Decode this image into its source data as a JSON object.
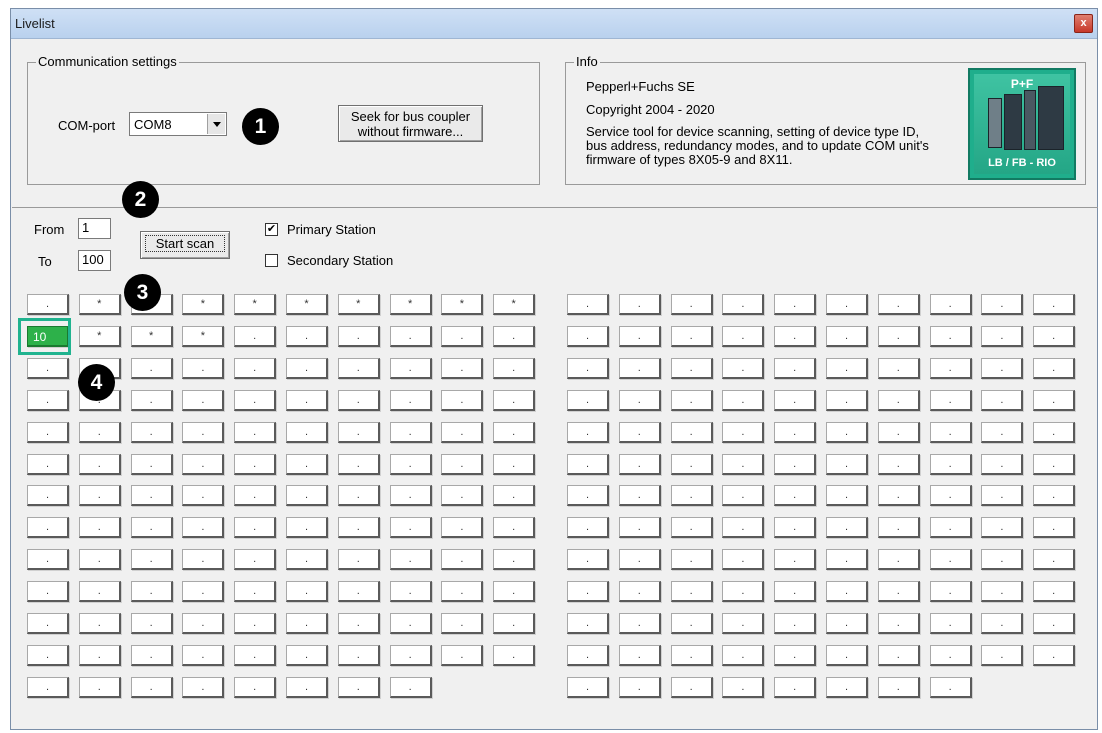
{
  "window": {
    "title": "Livelist",
    "close_label": "x"
  },
  "comm": {
    "legend": "Communication settings",
    "com_port_label": "COM-port",
    "com_port_value": "COM8",
    "seek_button": [
      "Seek for bus coupler",
      "without firmware..."
    ]
  },
  "info": {
    "legend": "Info",
    "company": "Pepperl+Fuchs SE",
    "copyright": "Copyright 2004 - 2020",
    "description": [
      "Service tool for device scanning, setting of device type ID,",
      "bus address, redundancy modes, and to update COM unit's",
      "firmware of types 8X05-9 and 8X11."
    ],
    "logo_top": "P+F",
    "logo_bottom": "LB / FB - RIO"
  },
  "scan": {
    "from_label": "From",
    "from_value": "1",
    "to_label": "To",
    "to_value": "100",
    "start_button": "Start scan",
    "primary_label": "Primary Station",
    "primary_checked": true,
    "secondary_label": "Secondary Station",
    "secondary_checked": false
  },
  "markers": [
    "1",
    "2",
    "3",
    "4"
  ],
  "grid": {
    "row_counts": [
      10,
      10,
      10,
      10,
      10,
      10,
      10,
      10,
      10,
      10,
      10,
      10,
      8
    ],
    "left_cells": [
      [
        ".",
        "*",
        "*",
        "*",
        "*",
        "*",
        "*",
        "*",
        "*",
        "*"
      ],
      [
        "10",
        "*",
        "*",
        "*",
        ".",
        ".",
        ".",
        ".",
        ".",
        "."
      ],
      [
        ".",
        ".",
        ".",
        ".",
        ".",
        ".",
        ".",
        ".",
        ".",
        "."
      ],
      [
        ".",
        ".",
        ".",
        ".",
        ".",
        ".",
        ".",
        ".",
        ".",
        "."
      ],
      [
        ".",
        ".",
        ".",
        ".",
        ".",
        ".",
        ".",
        ".",
        ".",
        "."
      ],
      [
        ".",
        ".",
        ".",
        ".",
        ".",
        ".",
        ".",
        ".",
        ".",
        "."
      ],
      [
        ".",
        ".",
        ".",
        ".",
        ".",
        ".",
        ".",
        ".",
        ".",
        "."
      ],
      [
        ".",
        ".",
        ".",
        ".",
        ".",
        ".",
        ".",
        ".",
        ".",
        "."
      ],
      [
        ".",
        ".",
        ".",
        ".",
        ".",
        ".",
        ".",
        ".",
        ".",
        "."
      ],
      [
        ".",
        ".",
        ".",
        ".",
        ".",
        ".",
        ".",
        ".",
        ".",
        "."
      ],
      [
        ".",
        ".",
        ".",
        ".",
        ".",
        ".",
        ".",
        ".",
        ".",
        "."
      ],
      [
        ".",
        ".",
        ".",
        ".",
        ".",
        ".",
        ".",
        ".",
        ".",
        "."
      ],
      [
        ".",
        ".",
        ".",
        ".",
        ".",
        ".",
        ".",
        "."
      ]
    ],
    "right_cell_value": ".",
    "found_color": "#2db14a",
    "highlight_color": "#20b38f"
  }
}
